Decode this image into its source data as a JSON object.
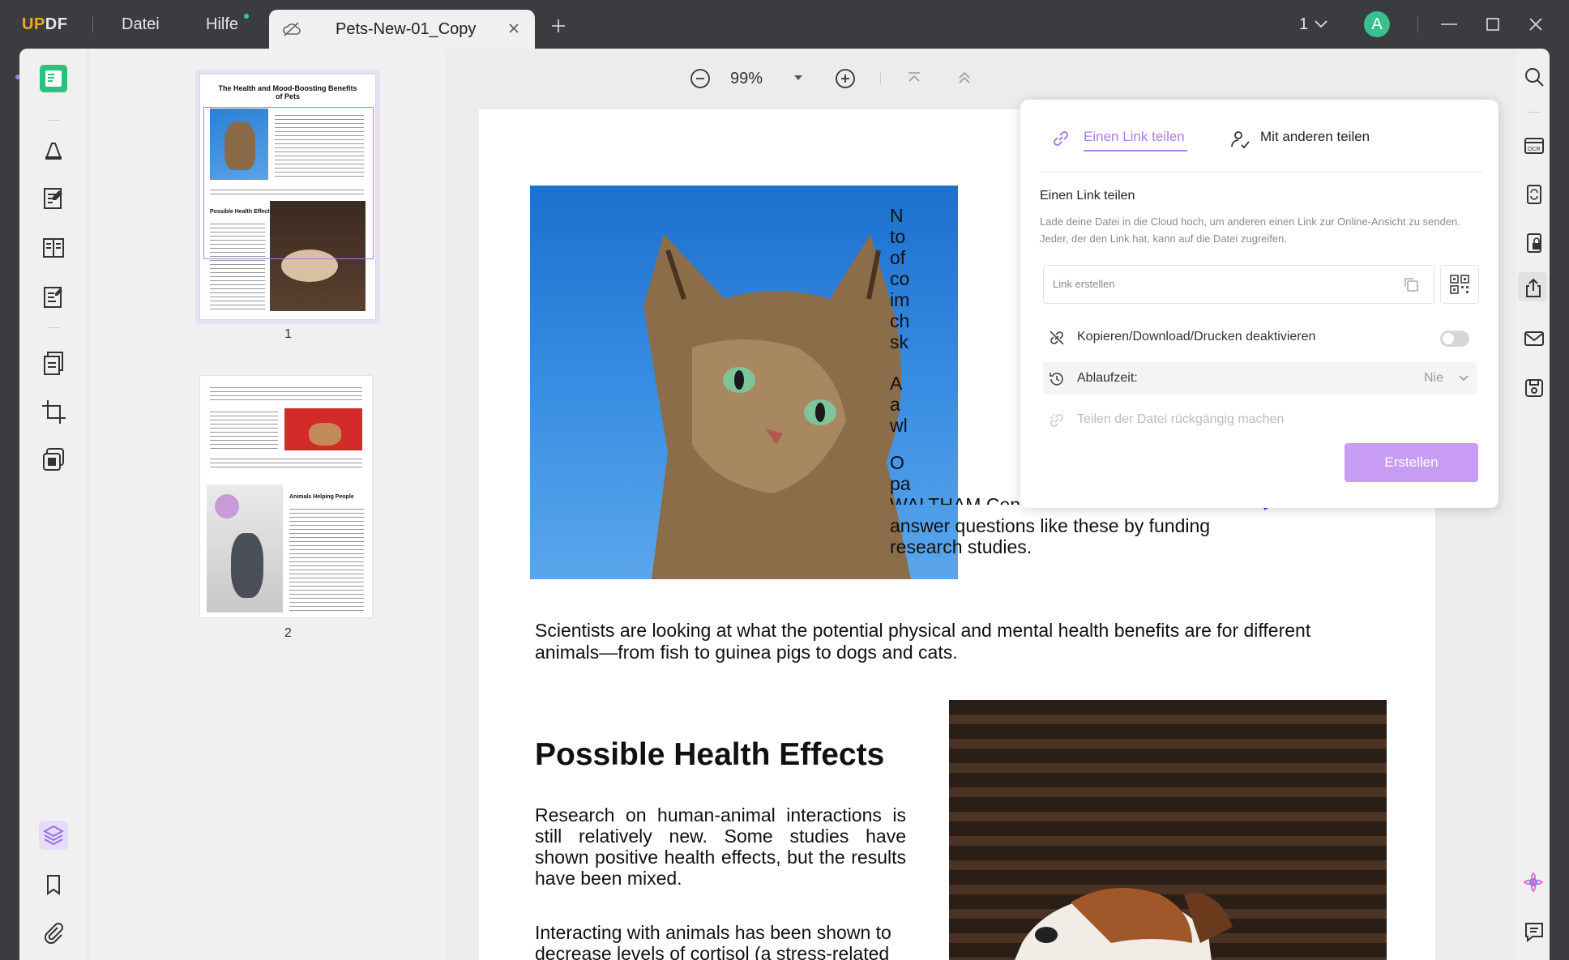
{
  "app": {
    "logo_a": "UP",
    "logo_b": "DF",
    "menu_file": "Datei",
    "menu_help": "Hilfe"
  },
  "tab": {
    "title": "Pets-New-01_Copy"
  },
  "window": {
    "page_indicator": "1",
    "avatar_letter": "A"
  },
  "toolbar": {
    "zoom": "99%"
  },
  "thumbnails": [
    {
      "label": "1",
      "title": "The Health and Mood-Boosting Benefits of Pets",
      "section": "Possible Health Effects"
    },
    {
      "label": "2",
      "section": "Animals Helping People"
    }
  ],
  "document": {
    "right_col_1": [
      "N",
      "to",
      "of",
      "co",
      "im",
      "ch",
      "sk"
    ],
    "right_col_2": [
      "A",
      "a",
      "wl"
    ],
    "right_col_3": [
      "O",
      "pa"
    ],
    "partial_line": "WALTHAM Centre for Pet Nutrition",
    "line_answer": "answer  questions  like these by funding",
    "line_research": "research studies.",
    "scientists": "Scientists are looking at what the potential physical and mental health benefits are for different animals—from fish to guinea pigs to dogs and cats.",
    "heading": "Possible Health Effects",
    "para1": "Research on human-animal interactions is still relatively new. Some studies have shown positive health effects, but the results have been mixed.",
    "para2": "Interacting with animals has been shown to decrease levels of cortisol (a stress-related hormone) and lower blood pressure. Other studies have found that animals can"
  },
  "share_popup": {
    "tab_link": "Einen Link teilen",
    "tab_others": "Mit anderen teilen",
    "heading": "Einen Link teilen",
    "description": "Lade deine Datei in die Cloud hoch, um anderen einen Link zur Online-Ansicht zu senden. Jeder, der den Link hat, kann auf die Datei zugreifen.",
    "link_placeholder": "Link erstellen",
    "disable_copy_label": "Kopieren/Download/Drucken deaktivieren",
    "expiry_label": "Ablaufzeit:",
    "expiry_value": "Nie",
    "undo_label": "Teilen der Datei rückgängig machen",
    "create_button": "Erstellen"
  },
  "colors": {
    "accent": "#b07ae8",
    "button": "#c89cf2",
    "titlebar": "#3b3c3f",
    "arrow": "#3b44d6",
    "avatar": "#39c08f"
  }
}
